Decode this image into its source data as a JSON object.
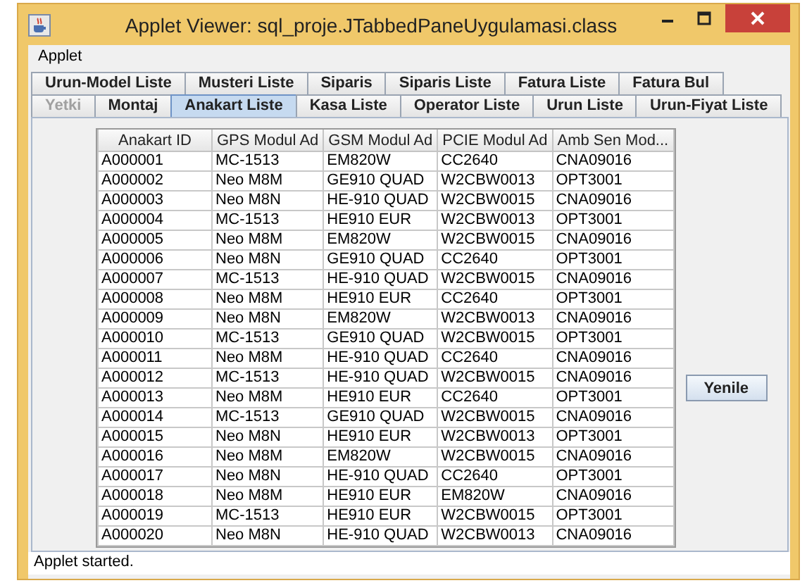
{
  "window": {
    "title": "Applet Viewer: sql_proje.JTabbedPaneUygulamasi.class"
  },
  "menu": [
    "Applet"
  ],
  "tab_rows": [
    [
      {
        "label": "Urun-Model Liste",
        "selected": false,
        "disabled": false
      },
      {
        "label": "Musteri Liste",
        "selected": false,
        "disabled": false
      },
      {
        "label": "Siparis",
        "selected": false,
        "disabled": false
      },
      {
        "label": "Siparis Liste",
        "selected": false,
        "disabled": false
      },
      {
        "label": "Fatura Liste",
        "selected": false,
        "disabled": false
      },
      {
        "label": "Fatura Bul",
        "selected": false,
        "disabled": false
      }
    ],
    [
      {
        "label": "Yetki",
        "selected": false,
        "disabled": true
      },
      {
        "label": "Montaj",
        "selected": false,
        "disabled": false
      },
      {
        "label": "Anakart Liste",
        "selected": true,
        "disabled": false
      },
      {
        "label": "Kasa Liste",
        "selected": false,
        "disabled": false
      },
      {
        "label": "Operator Liste",
        "selected": false,
        "disabled": false
      },
      {
        "label": "Urun Liste",
        "selected": false,
        "disabled": false
      },
      {
        "label": "Urun-Fiyat Liste",
        "selected": false,
        "disabled": false
      }
    ]
  ],
  "table": {
    "columns": [
      "Anakart ID",
      "GPS Modul Ad",
      "GSM Modul Ad",
      "PCIE Modul Ad",
      "Amb Sen Mod..."
    ],
    "rows": [
      [
        "A000001",
        "MC-1513",
        "EM820W",
        "CC2640",
        "CNA09016"
      ],
      [
        "A000002",
        "Neo M8M",
        "GE910 QUAD",
        "W2CBW0013",
        "OPT3001"
      ],
      [
        "A000003",
        "Neo M8N",
        "HE-910 QUAD",
        "W2CBW0015",
        "CNA09016"
      ],
      [
        "A000004",
        "MC-1513",
        "HE910 EUR",
        "W2CBW0013",
        "OPT3001"
      ],
      [
        "A000005",
        "Neo M8M",
        "EM820W",
        "W2CBW0015",
        "CNA09016"
      ],
      [
        "A000006",
        "Neo M8N",
        "GE910 QUAD",
        "CC2640",
        "OPT3001"
      ],
      [
        "A000007",
        "MC-1513",
        "HE-910 QUAD",
        "W2CBW0015",
        "CNA09016"
      ],
      [
        "A000008",
        "Neo M8M",
        "HE910 EUR",
        "CC2640",
        "OPT3001"
      ],
      [
        "A000009",
        "Neo M8N",
        "EM820W",
        "W2CBW0013",
        "CNA09016"
      ],
      [
        "A000010",
        "MC-1513",
        "GE910 QUAD",
        "W2CBW0015",
        "OPT3001"
      ],
      [
        "A000011",
        "Neo M8M",
        "HE-910 QUAD",
        "CC2640",
        "CNA09016"
      ],
      [
        "A000012",
        "MC-1513",
        "HE-910 QUAD",
        "W2CBW0015",
        "CNA09016"
      ],
      [
        "A000013",
        "Neo M8M",
        "HE910 EUR",
        "CC2640",
        "OPT3001"
      ],
      [
        "A000014",
        "MC-1513",
        "GE910 QUAD",
        "W2CBW0015",
        "CNA09016"
      ],
      [
        "A000015",
        "Neo M8N",
        "HE910 EUR",
        "W2CBW0013",
        "OPT3001"
      ],
      [
        "A000016",
        "Neo M8M",
        "EM820W",
        "W2CBW0015",
        "CNA09016"
      ],
      [
        "A000017",
        "Neo M8N",
        "HE-910 QUAD",
        "CC2640",
        "OPT3001"
      ],
      [
        "A000018",
        "Neo M8M",
        "HE910 EUR",
        "EM820W",
        "CNA09016"
      ],
      [
        "A000019",
        "MC-1513",
        "HE910 EUR",
        "W2CBW0015",
        "OPT3001"
      ],
      [
        "A000020",
        "Neo M8N",
        "HE-910 QUAD",
        "W2CBW0013",
        "CNA09016"
      ]
    ]
  },
  "buttons": [
    "Yenile"
  ],
  "status_bar": "Applet started."
}
